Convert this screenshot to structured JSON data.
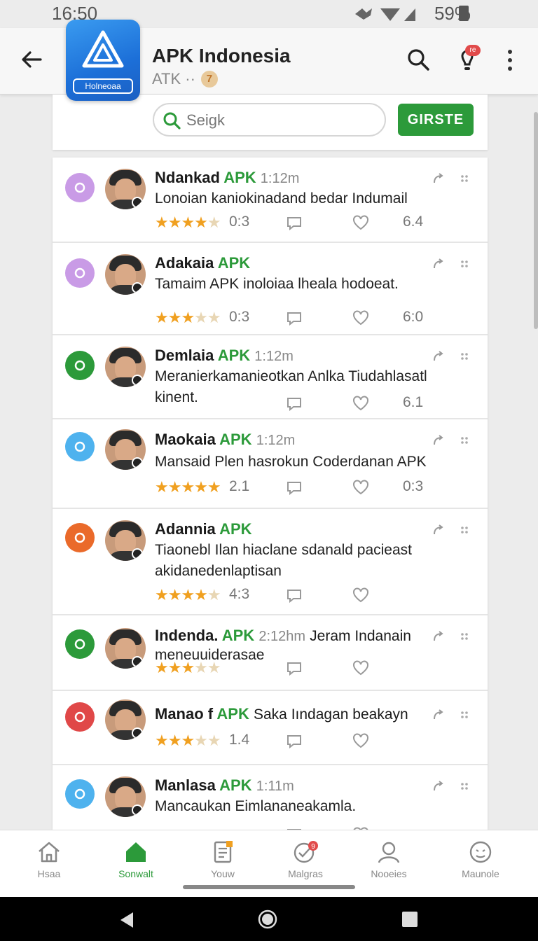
{
  "status": {
    "time": "16:50",
    "battery": "59%"
  },
  "appbar": {
    "title": "APK Indonesia",
    "subtitle": "ATK ··",
    "badge": "7",
    "logo_label": "Holneoaa",
    "notif_badge": "re"
  },
  "search": {
    "placeholder": "Seigk",
    "button_label": "GIRSTE"
  },
  "feed": [
    {
      "name": "Ndankad",
      "apk": "APK",
      "time": "1:12m",
      "text": "Lonoian kaniokinadand bedar Indumail",
      "stars": 3.5,
      "rating": "0:3",
      "count": "6.4",
      "cat_color": "#c99be6"
    },
    {
      "name": "Adakaia",
      "apk": "APK",
      "time": "",
      "text": "Tamaim APK inoloiaa lhealа hodoeat.",
      "stars": 3,
      "rating": "0:3",
      "count": "6:0",
      "cat_color": "#c99be6"
    },
    {
      "name": "Demlaia",
      "apk": "APK",
      "time": "1:12m",
      "text": "Meranierkamanieotkan Anlka Tiudahlasatl kinent.",
      "stars": 0,
      "rating": "",
      "count": "6.1",
      "cat_color": "#2c9a3a"
    },
    {
      "name": "Maokaia",
      "apk": "APK",
      "time": "1:12m",
      "text": "Mansaid Plen hаsrokun Coderdanan APK",
      "stars": 4.5,
      "rating": "2.1",
      "count": "0:3",
      "cat_color": "#4eb2ee"
    },
    {
      "name": "Adannia",
      "apk": "APK",
      "time": "",
      "text": "Tiaonebl Ilan hiaclane sdanald pacieast akidanedenlaptisan",
      "stars": 3.5,
      "rating": "4:3",
      "count": "",
      "cat_color": "#ea6a2a"
    },
    {
      "name": "Indenda.",
      "apk": "APK",
      "time": "2:12hm",
      "extra": "Jeram Indanain",
      "text": "meneuuiderasae",
      "stars": 3,
      "rating": "",
      "count": "",
      "cat_color": "#2c9a3a"
    },
    {
      "name": "Manao f",
      "apk": "APK",
      "time": "",
      "extra": "Saka Iındagan beakayn",
      "text": "",
      "stars": 3,
      "rating": "1.4",
      "count": "",
      "cat_color": "#e04848"
    },
    {
      "name": "Manlasa",
      "apk": "APK",
      "time": "1:11m",
      "text": "Mancaukan Eimlananeakamla.",
      "stars": 0,
      "rating": "",
      "count": "",
      "cat_color": "#4eb2ee"
    }
  ],
  "nav": [
    {
      "label": "Hsaa",
      "icon": "home-outline-icon"
    },
    {
      "label": "Sonwalt",
      "icon": "home-filled-icon",
      "active": true
    },
    {
      "label": "Youw",
      "icon": "document-icon"
    },
    {
      "label": "Malgras",
      "icon": "chat-check-icon",
      "badge": "9"
    },
    {
      "label": "Nooeies",
      "icon": "person-icon"
    },
    {
      "label": "Maunole",
      "icon": "face-icon"
    }
  ],
  "colors": {
    "accent_green": "#2c9a3a",
    "star": "#f0a020",
    "badge_red": "#e14b4b"
  }
}
